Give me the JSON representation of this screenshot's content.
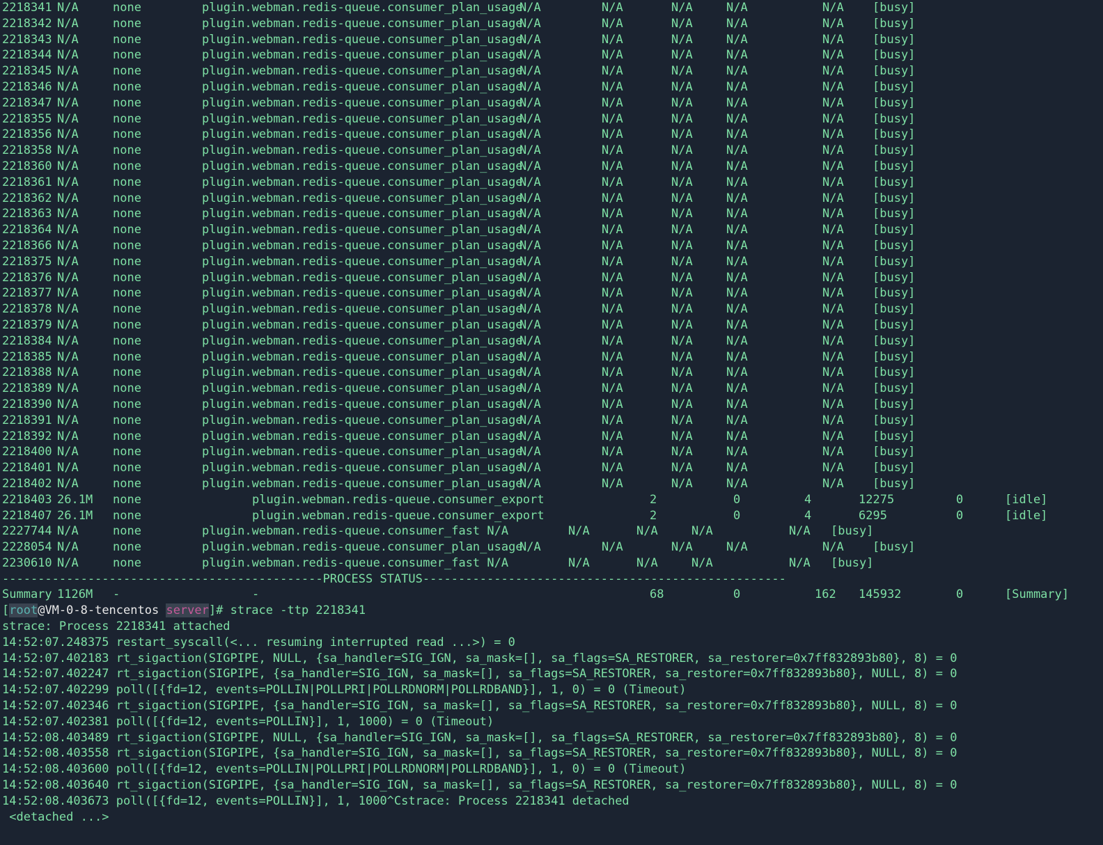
{
  "terminal": {
    "colors": {
      "background": "#1b2330",
      "text": "#7ee0a4",
      "prompt_user": "#59b3b0",
      "prompt_dir": "#c65a9a",
      "prompt_host": "#e8e8e8"
    },
    "process_rows": [
      {
        "pid": "2218341",
        "mem": "N/A",
        "peer": "none",
        "name": "plugin.webman.redis-queue.consumer_plan_usage",
        "c1": "N/A",
        "c2": "N/A",
        "c3": "N/A",
        "c4": "N/A",
        "c5": "N/A",
        "status": "[busy]"
      },
      {
        "pid": "2218342",
        "mem": "N/A",
        "peer": "none",
        "name": "plugin.webman.redis-queue.consumer_plan_usage",
        "c1": "N/A",
        "c2": "N/A",
        "c3": "N/A",
        "c4": "N/A",
        "c5": "N/A",
        "status": "[busy]"
      },
      {
        "pid": "2218343",
        "mem": "N/A",
        "peer": "none",
        "name": "plugin.webman.redis-queue.consumer_plan_usage",
        "c1": "N/A",
        "c2": "N/A",
        "c3": "N/A",
        "c4": "N/A",
        "c5": "N/A",
        "status": "[busy]"
      },
      {
        "pid": "2218344",
        "mem": "N/A",
        "peer": "none",
        "name": "plugin.webman.redis-queue.consumer_plan_usage",
        "c1": "N/A",
        "c2": "N/A",
        "c3": "N/A",
        "c4": "N/A",
        "c5": "N/A",
        "status": "[busy]"
      },
      {
        "pid": "2218345",
        "mem": "N/A",
        "peer": "none",
        "name": "plugin.webman.redis-queue.consumer_plan_usage",
        "c1": "N/A",
        "c2": "N/A",
        "c3": "N/A",
        "c4": "N/A",
        "c5": "N/A",
        "status": "[busy]"
      },
      {
        "pid": "2218346",
        "mem": "N/A",
        "peer": "none",
        "name": "plugin.webman.redis-queue.consumer_plan_usage",
        "c1": "N/A",
        "c2": "N/A",
        "c3": "N/A",
        "c4": "N/A",
        "c5": "N/A",
        "status": "[busy]"
      },
      {
        "pid": "2218347",
        "mem": "N/A",
        "peer": "none",
        "name": "plugin.webman.redis-queue.consumer_plan_usage",
        "c1": "N/A",
        "c2": "N/A",
        "c3": "N/A",
        "c4": "N/A",
        "c5": "N/A",
        "status": "[busy]"
      },
      {
        "pid": "2218355",
        "mem": "N/A",
        "peer": "none",
        "name": "plugin.webman.redis-queue.consumer_plan_usage",
        "c1": "N/A",
        "c2": "N/A",
        "c3": "N/A",
        "c4": "N/A",
        "c5": "N/A",
        "status": "[busy]"
      },
      {
        "pid": "2218356",
        "mem": "N/A",
        "peer": "none",
        "name": "plugin.webman.redis-queue.consumer_plan_usage",
        "c1": "N/A",
        "c2": "N/A",
        "c3": "N/A",
        "c4": "N/A",
        "c5": "N/A",
        "status": "[busy]"
      },
      {
        "pid": "2218358",
        "mem": "N/A",
        "peer": "none",
        "name": "plugin.webman.redis-queue.consumer_plan_usage",
        "c1": "N/A",
        "c2": "N/A",
        "c3": "N/A",
        "c4": "N/A",
        "c5": "N/A",
        "status": "[busy]"
      },
      {
        "pid": "2218360",
        "mem": "N/A",
        "peer": "none",
        "name": "plugin.webman.redis-queue.consumer_plan_usage",
        "c1": "N/A",
        "c2": "N/A",
        "c3": "N/A",
        "c4": "N/A",
        "c5": "N/A",
        "status": "[busy]"
      },
      {
        "pid": "2218361",
        "mem": "N/A",
        "peer": "none",
        "name": "plugin.webman.redis-queue.consumer_plan_usage",
        "c1": "N/A",
        "c2": "N/A",
        "c3": "N/A",
        "c4": "N/A",
        "c5": "N/A",
        "status": "[busy]"
      },
      {
        "pid": "2218362",
        "mem": "N/A",
        "peer": "none",
        "name": "plugin.webman.redis-queue.consumer_plan_usage",
        "c1": "N/A",
        "c2": "N/A",
        "c3": "N/A",
        "c4": "N/A",
        "c5": "N/A",
        "status": "[busy]"
      },
      {
        "pid": "2218363",
        "mem": "N/A",
        "peer": "none",
        "name": "plugin.webman.redis-queue.consumer_plan_usage",
        "c1": "N/A",
        "c2": "N/A",
        "c3": "N/A",
        "c4": "N/A",
        "c5": "N/A",
        "status": "[busy]"
      },
      {
        "pid": "2218364",
        "mem": "N/A",
        "peer": "none",
        "name": "plugin.webman.redis-queue.consumer_plan_usage",
        "c1": "N/A",
        "c2": "N/A",
        "c3": "N/A",
        "c4": "N/A",
        "c5": "N/A",
        "status": "[busy]"
      },
      {
        "pid": "2218366",
        "mem": "N/A",
        "peer": "none",
        "name": "plugin.webman.redis-queue.consumer_plan_usage",
        "c1": "N/A",
        "c2": "N/A",
        "c3": "N/A",
        "c4": "N/A",
        "c5": "N/A",
        "status": "[busy]"
      },
      {
        "pid": "2218375",
        "mem": "N/A",
        "peer": "none",
        "name": "plugin.webman.redis-queue.consumer_plan_usage",
        "c1": "N/A",
        "c2": "N/A",
        "c3": "N/A",
        "c4": "N/A",
        "c5": "N/A",
        "status": "[busy]"
      },
      {
        "pid": "2218376",
        "mem": "N/A",
        "peer": "none",
        "name": "plugin.webman.redis-queue.consumer_plan_usage",
        "c1": "N/A",
        "c2": "N/A",
        "c3": "N/A",
        "c4": "N/A",
        "c5": "N/A",
        "status": "[busy]"
      },
      {
        "pid": "2218377",
        "mem": "N/A",
        "peer": "none",
        "name": "plugin.webman.redis-queue.consumer_plan_usage",
        "c1": "N/A",
        "c2": "N/A",
        "c3": "N/A",
        "c4": "N/A",
        "c5": "N/A",
        "status": "[busy]"
      },
      {
        "pid": "2218378",
        "mem": "N/A",
        "peer": "none",
        "name": "plugin.webman.redis-queue.consumer_plan_usage",
        "c1": "N/A",
        "c2": "N/A",
        "c3": "N/A",
        "c4": "N/A",
        "c5": "N/A",
        "status": "[busy]"
      },
      {
        "pid": "2218379",
        "mem": "N/A",
        "peer": "none",
        "name": "plugin.webman.redis-queue.consumer_plan_usage",
        "c1": "N/A",
        "c2": "N/A",
        "c3": "N/A",
        "c4": "N/A",
        "c5": "N/A",
        "status": "[busy]"
      },
      {
        "pid": "2218384",
        "mem": "N/A",
        "peer": "none",
        "name": "plugin.webman.redis-queue.consumer_plan_usage",
        "c1": "N/A",
        "c2": "N/A",
        "c3": "N/A",
        "c4": "N/A",
        "c5": "N/A",
        "status": "[busy]"
      },
      {
        "pid": "2218385",
        "mem": "N/A",
        "peer": "none",
        "name": "plugin.webman.redis-queue.consumer_plan_usage",
        "c1": "N/A",
        "c2": "N/A",
        "c3": "N/A",
        "c4": "N/A",
        "c5": "N/A",
        "status": "[busy]"
      },
      {
        "pid": "2218388",
        "mem": "N/A",
        "peer": "none",
        "name": "plugin.webman.redis-queue.consumer_plan_usage",
        "c1": "N/A",
        "c2": "N/A",
        "c3": "N/A",
        "c4": "N/A",
        "c5": "N/A",
        "status": "[busy]"
      },
      {
        "pid": "2218389",
        "mem": "N/A",
        "peer": "none",
        "name": "plugin.webman.redis-queue.consumer_plan_usage",
        "c1": "N/A",
        "c2": "N/A",
        "c3": "N/A",
        "c4": "N/A",
        "c5": "N/A",
        "status": "[busy]"
      },
      {
        "pid": "2218390",
        "mem": "N/A",
        "peer": "none",
        "name": "plugin.webman.redis-queue.consumer_plan_usage",
        "c1": "N/A",
        "c2": "N/A",
        "c3": "N/A",
        "c4": "N/A",
        "c5": "N/A",
        "status": "[busy]"
      },
      {
        "pid": "2218391",
        "mem": "N/A",
        "peer": "none",
        "name": "plugin.webman.redis-queue.consumer_plan_usage",
        "c1": "N/A",
        "c2": "N/A",
        "c3": "N/A",
        "c4": "N/A",
        "c5": "N/A",
        "status": "[busy]"
      },
      {
        "pid": "2218392",
        "mem": "N/A",
        "peer": "none",
        "name": "plugin.webman.redis-queue.consumer_plan_usage",
        "c1": "N/A",
        "c2": "N/A",
        "c3": "N/A",
        "c4": "N/A",
        "c5": "N/A",
        "status": "[busy]"
      },
      {
        "pid": "2218400",
        "mem": "N/A",
        "peer": "none",
        "name": "plugin.webman.redis-queue.consumer_plan_usage",
        "c1": "N/A",
        "c2": "N/A",
        "c3": "N/A",
        "c4": "N/A",
        "c5": "N/A",
        "status": "[busy]"
      },
      {
        "pid": "2218401",
        "mem": "N/A",
        "peer": "none",
        "name": "plugin.webman.redis-queue.consumer_plan_usage",
        "c1": "N/A",
        "c2": "N/A",
        "c3": "N/A",
        "c4": "N/A",
        "c5": "N/A",
        "status": "[busy]"
      },
      {
        "pid": "2218402",
        "mem": "N/A",
        "peer": "none",
        "name": "plugin.webman.redis-queue.consumer_plan_usage",
        "c1": "N/A",
        "c2": "N/A",
        "c3": "N/A",
        "c4": "N/A",
        "c5": "N/A",
        "status": "[busy]"
      },
      {
        "pid": "2218403",
        "mem": "26.1M",
        "peer": "none",
        "name": "plugin.webman.redis-queue.consumer_export",
        "c1": "2",
        "c2": "0",
        "c3": "4",
        "c4": "12275",
        "c5": "0",
        "status": "[idle]"
      },
      {
        "pid": "2218407",
        "mem": "26.1M",
        "peer": "none",
        "name": "plugin.webman.redis-queue.consumer_export",
        "c1": "2",
        "c2": "0",
        "c3": "4",
        "c4": "6295",
        "c5": "0",
        "status": "[idle]"
      },
      {
        "pid": "2227744",
        "mem": "N/A",
        "peer": "none",
        "name": "plugin.webman.redis-queue.consumer_fast N/A",
        "c1": "N/A",
        "c2": "N/A",
        "c3": "N/A",
        "c4": "N/A",
        "c5": "",
        "status": "[busy]"
      },
      {
        "pid": "2228054",
        "mem": "N/A",
        "peer": "none",
        "name": "plugin.webman.redis-queue.consumer_plan_usage",
        "c1": "N/A",
        "c2": "N/A",
        "c3": "N/A",
        "c4": "N/A",
        "c5": "N/A",
        "status": "[busy]"
      },
      {
        "pid": "2230610",
        "mem": "N/A",
        "peer": "none",
        "name": "plugin.webman.redis-queue.consumer_fast N/A",
        "c1": "N/A",
        "c2": "N/A",
        "c3": "N/A",
        "c4": "N/A",
        "c5": "",
        "status": "[busy]"
      }
    ],
    "status_divider": "---------------------------------------------PROCESS STATUS---------------------------------------------------",
    "summary": {
      "label": "Summary",
      "mem": "1126M",
      "peer": "-",
      "name": "-",
      "c1": "68",
      "c2": "0",
      "c3": "162",
      "c4": "145932",
      "c5": "0",
      "status": "[Summary]"
    },
    "prompt": {
      "open_bracket": "[",
      "user": "root",
      "host": "@VM-0-8-tencentos",
      "space": " ",
      "dir": "server",
      "close": "]#",
      "command": " strace -ttp 2218341"
    },
    "strace_lines": [
      "strace: Process 2218341 attached",
      "14:52:07.248375 restart_syscall(<... resuming interrupted read ...>) = 0",
      "14:52:07.402183 rt_sigaction(SIGPIPE, NULL, {sa_handler=SIG_IGN, sa_mask=[], sa_flags=SA_RESTORER, sa_restorer=0x7ff832893b80}, 8) = 0",
      "14:52:07.402247 rt_sigaction(SIGPIPE, {sa_handler=SIG_IGN, sa_mask=[], sa_flags=SA_RESTORER, sa_restorer=0x7ff832893b80}, NULL, 8) = 0",
      "14:52:07.402299 poll([{fd=12, events=POLLIN|POLLPRI|POLLRDNORM|POLLRDBAND}], 1, 0) = 0 (Timeout)",
      "14:52:07.402346 rt_sigaction(SIGPIPE, {sa_handler=SIG_IGN, sa_mask=[], sa_flags=SA_RESTORER, sa_restorer=0x7ff832893b80}, NULL, 8) = 0",
      "14:52:07.402381 poll([{fd=12, events=POLLIN}], 1, 1000) = 0 (Timeout)",
      "14:52:08.403489 rt_sigaction(SIGPIPE, NULL, {sa_handler=SIG_IGN, sa_mask=[], sa_flags=SA_RESTORER, sa_restorer=0x7ff832893b80}, 8) = 0",
      "14:52:08.403558 rt_sigaction(SIGPIPE, {sa_handler=SIG_IGN, sa_mask=[], sa_flags=SA_RESTORER, sa_restorer=0x7ff832893b80}, NULL, 8) = 0",
      "14:52:08.403600 poll([{fd=12, events=POLLIN|POLLPRI|POLLRDNORM|POLLRDBAND}], 1, 0) = 0 (Timeout)",
      "14:52:08.403640 rt_sigaction(SIGPIPE, {sa_handler=SIG_IGN, sa_mask=[], sa_flags=SA_RESTORER, sa_restorer=0x7ff832893b80}, NULL, 8) = 0",
      "14:52:08.403673 poll([{fd=12, events=POLLIN}], 1, 1000^Cstrace: Process 2218341 detached",
      " <detached ...>"
    ]
  }
}
